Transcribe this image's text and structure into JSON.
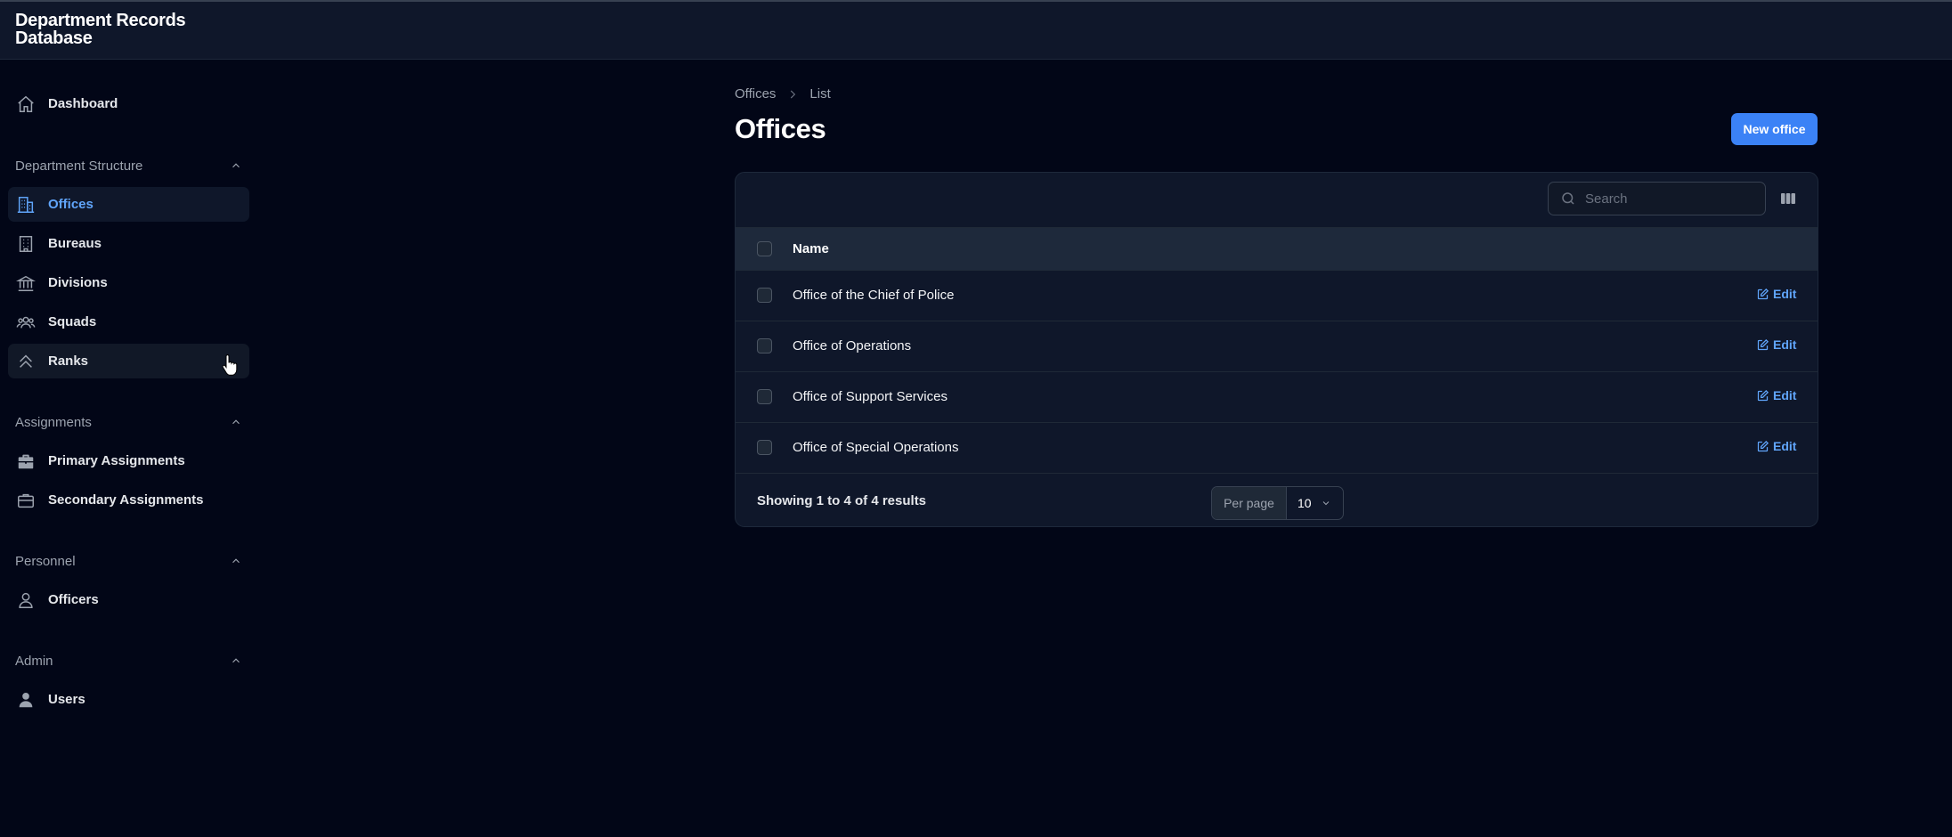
{
  "app": {
    "title_line1": "Department Records",
    "title_line2": "Database"
  },
  "sidebar": {
    "dashboard": {
      "label": "Dashboard",
      "icon": "home-icon"
    },
    "groups": [
      {
        "label": "Department Structure",
        "items": [
          {
            "label": "Offices",
            "icon": "building-office-icon",
            "active": true
          },
          {
            "label": "Bureaus",
            "icon": "building-icon"
          },
          {
            "label": "Divisions",
            "icon": "bank-icon"
          },
          {
            "label": "Squads",
            "icon": "user-group-icon"
          },
          {
            "label": "Ranks",
            "icon": "chevron-double-up-icon",
            "hover": true
          }
        ]
      },
      {
        "label": "Assignments",
        "items": [
          {
            "label": "Primary Assignments",
            "icon": "briefcase-solid-icon"
          },
          {
            "label": "Secondary Assignments",
            "icon": "briefcase-icon"
          }
        ]
      },
      {
        "label": "Personnel",
        "items": [
          {
            "label": "Officers",
            "icon": "user-icon"
          }
        ]
      },
      {
        "label": "Admin",
        "items": [
          {
            "label": "Users",
            "icon": "user-solid-icon"
          }
        ]
      }
    ]
  },
  "main": {
    "breadcrumb": [
      "Offices",
      "List"
    ],
    "title": "Offices",
    "new_button": "New office",
    "search_placeholder": "Search",
    "table": {
      "column_name": "Name",
      "edit_label": "Edit",
      "rows": [
        "Office of the Chief of Police",
        "Office of Operations",
        "Office of Support Services",
        "Office of Special Operations"
      ]
    },
    "footer": {
      "showing": "Showing 1 to 4 of 4 results",
      "per_page_label": "Per page",
      "per_page_value": "10"
    }
  },
  "colors": {
    "background": "#020617",
    "accent": "#3b82f6",
    "link": "#60a5fa"
  }
}
